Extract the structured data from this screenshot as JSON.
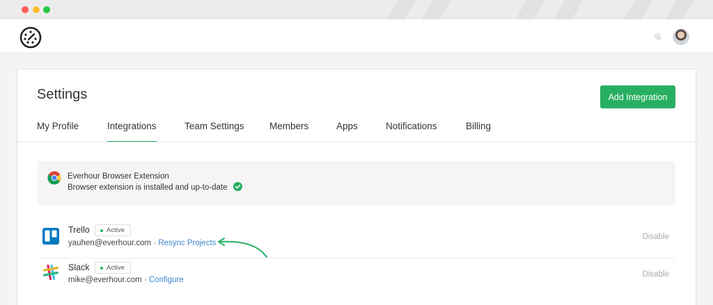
{
  "header": {
    "logo_icon": "everhour-clock-logo",
    "notification_icon": "bell-icon"
  },
  "page": {
    "title": "Settings",
    "add_button": "Add Integration"
  },
  "tabs": [
    {
      "label": "My Profile",
      "active": false
    },
    {
      "label": "Integrations",
      "active": true
    },
    {
      "label": "Team Settings",
      "active": false
    },
    {
      "label": "Members",
      "active": false
    },
    {
      "label": "Apps",
      "active": false
    },
    {
      "label": "Notifications",
      "active": false
    },
    {
      "label": "Billing",
      "active": false
    }
  ],
  "extension": {
    "title": "Everhour Browser Extension",
    "description": "Browser extension is installed and up-to-date"
  },
  "integrations": [
    {
      "name": "Trello",
      "status": "Active",
      "email": "yauhen@everhour.com",
      "separator": " · ",
      "action": "Resync Projects",
      "disable": "Disable"
    },
    {
      "name": "Slack",
      "status": "Active",
      "email": "mike@everhour.com",
      "separator": " · ",
      "action": "Configure",
      "disable": "Disable"
    }
  ],
  "colors": {
    "accent": "#27b062",
    "link": "#3f86c9",
    "trello": "#0079bf"
  }
}
